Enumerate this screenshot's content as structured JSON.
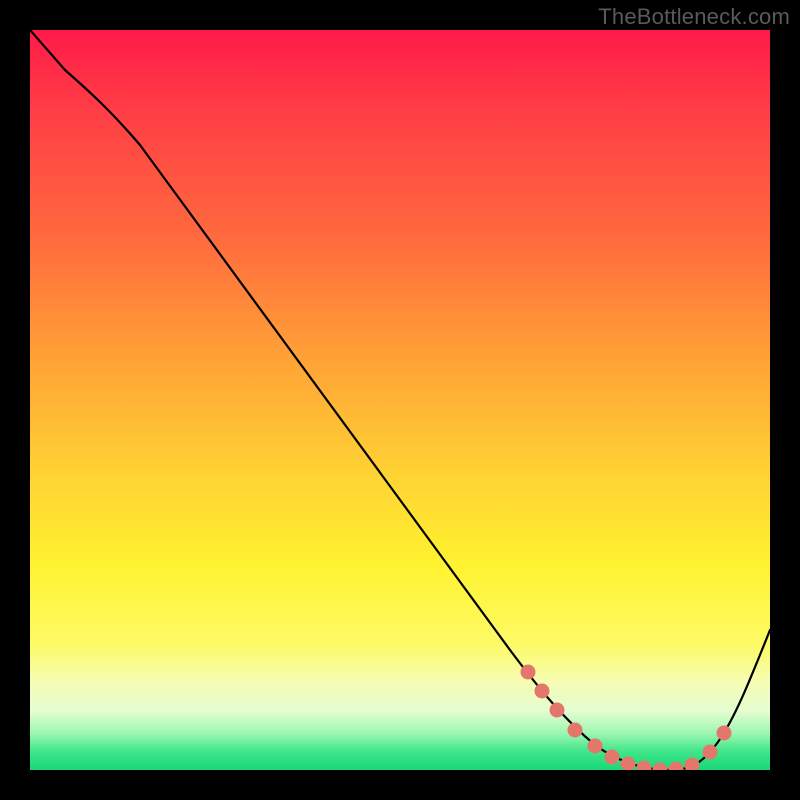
{
  "watermark": "TheBottleneck.com",
  "colors": {
    "frame": "#000000",
    "curve": "#000000",
    "dot": "#e4776c"
  },
  "chart_data": {
    "type": "line",
    "title": "",
    "xlabel": "",
    "ylabel": "",
    "xlim": [
      0,
      100
    ],
    "ylim": [
      0,
      100
    ],
    "x": [
      0,
      6,
      12,
      18,
      24,
      30,
      36,
      42,
      48,
      54,
      60,
      64,
      68,
      72,
      76,
      80,
      84,
      88,
      92,
      96,
      100
    ],
    "values": [
      100,
      94,
      87,
      79,
      71,
      63,
      56,
      48,
      40,
      33,
      25,
      19,
      13,
      7,
      3,
      1,
      0,
      0,
      2,
      9,
      19
    ],
    "dots_x": [
      68,
      70,
      72,
      75,
      77,
      79,
      81,
      83,
      85,
      87,
      89,
      91,
      92
    ],
    "dots_y": [
      13,
      11,
      7,
      5,
      3,
      2,
      1,
      0,
      0,
      0,
      2,
      4,
      9
    ],
    "grid": false,
    "legend": false
  }
}
